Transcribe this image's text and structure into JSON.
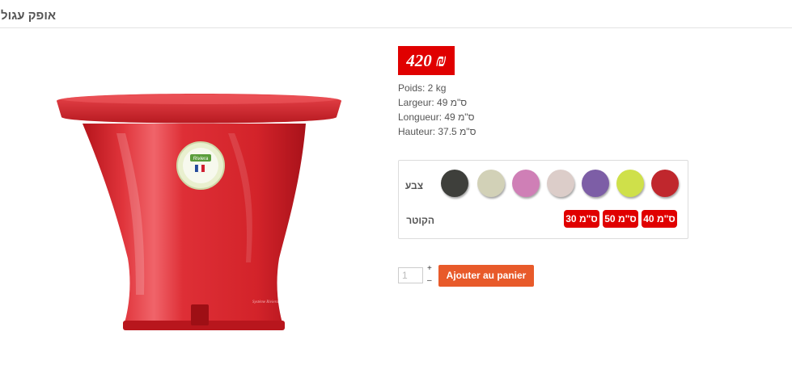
{
  "product": {
    "title": "אופק עגול",
    "price": "420 ₪",
    "specs": [
      "Poids: 2 kg",
      "Largeur: 49 ס\"מ",
      "Longueur: 49 ס\"מ",
      "Hauteur: 37.5 ס\"מ"
    ],
    "image_logo_text": "Riviera",
    "image_label_text": "Système Riviera"
  },
  "options": {
    "color_label": "צבע",
    "size_label": "הקוטר",
    "colors": [
      {
        "name": "red",
        "hex": "#c0272d"
      },
      {
        "name": "lime",
        "hex": "#cfe04a"
      },
      {
        "name": "purple",
        "hex": "#7d5ea6"
      },
      {
        "name": "beige",
        "hex": "#dccdc9"
      },
      {
        "name": "pink",
        "hex": "#cf7fb6"
      },
      {
        "name": "cream",
        "hex": "#d2d1b7"
      },
      {
        "name": "anthracite",
        "hex": "#3e3f3b"
      }
    ],
    "sizes": [
      "ס\"מ 40",
      "ס\"מ 50",
      "ס\"מ 30"
    ]
  },
  "cart": {
    "quantity": "1",
    "plus": "+",
    "minus": "–",
    "add_label": "Ajouter au panier"
  },
  "colors": {
    "accent_red": "#e00000",
    "button_orange": "#e85a2a",
    "pot_red": "#d8262e"
  }
}
